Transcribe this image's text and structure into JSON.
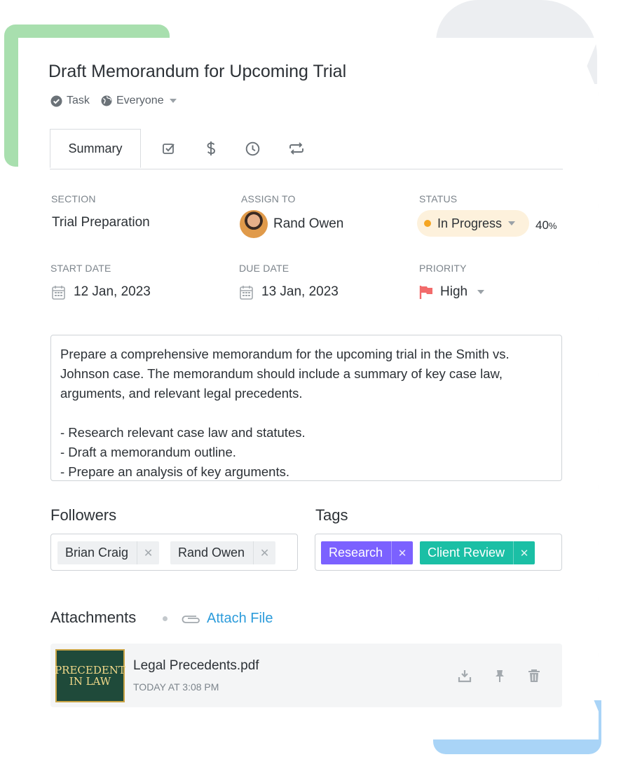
{
  "task": {
    "title": "Draft Memorandum for Upcoming Trial",
    "type_label": "Task",
    "visibility_label": "Everyone"
  },
  "tabs": {
    "summary_label": "Summary",
    "icons": [
      "checklist-icon",
      "dollar-icon",
      "clock-icon",
      "repeat-icon"
    ]
  },
  "fields": {
    "section_label": "SECTION",
    "section_value": "Trial Preparation",
    "assign_label": "ASSIGN TO",
    "assign_value": "Rand Owen",
    "status_label": "STATUS",
    "status_value": "In Progress",
    "status_color": "#f5a623",
    "progress_value": "40",
    "progress_unit": "%",
    "start_label": "START DATE",
    "start_value": "12 Jan, 2023",
    "due_label": "DUE DATE",
    "due_value": "13 Jan, 2023",
    "priority_label": "PRIORITY",
    "priority_value": "High",
    "priority_color": "#f26b6b"
  },
  "description": {
    "lines": [
      "Prepare a comprehensive memorandum for the upcoming trial in the Smith vs.",
      "Johnson case. The memorandum should include a summary of key case law,",
      "arguments, and relevant legal precedents.",
      "",
      "- Research relevant case law and statutes.",
      "- Draft a memorandum outline.",
      "- Prepare an analysis of key arguments."
    ]
  },
  "followers": {
    "heading": "Followers",
    "items": [
      "Brian Craig",
      "Rand Owen"
    ]
  },
  "tags": {
    "heading": "Tags",
    "items": [
      {
        "label": "Research",
        "color": "#7b61ff"
      },
      {
        "label": "Client Review",
        "color": "#1bbfa5"
      }
    ]
  },
  "attachments": {
    "heading": "Attachments",
    "attach_label": "Attach File",
    "accent": "#2d9cdb",
    "file_name": "Legal Precedents.pdf",
    "file_time": "TODAY AT 3:08 PM",
    "thumb_text": "PRECEDENT IN LAW"
  }
}
